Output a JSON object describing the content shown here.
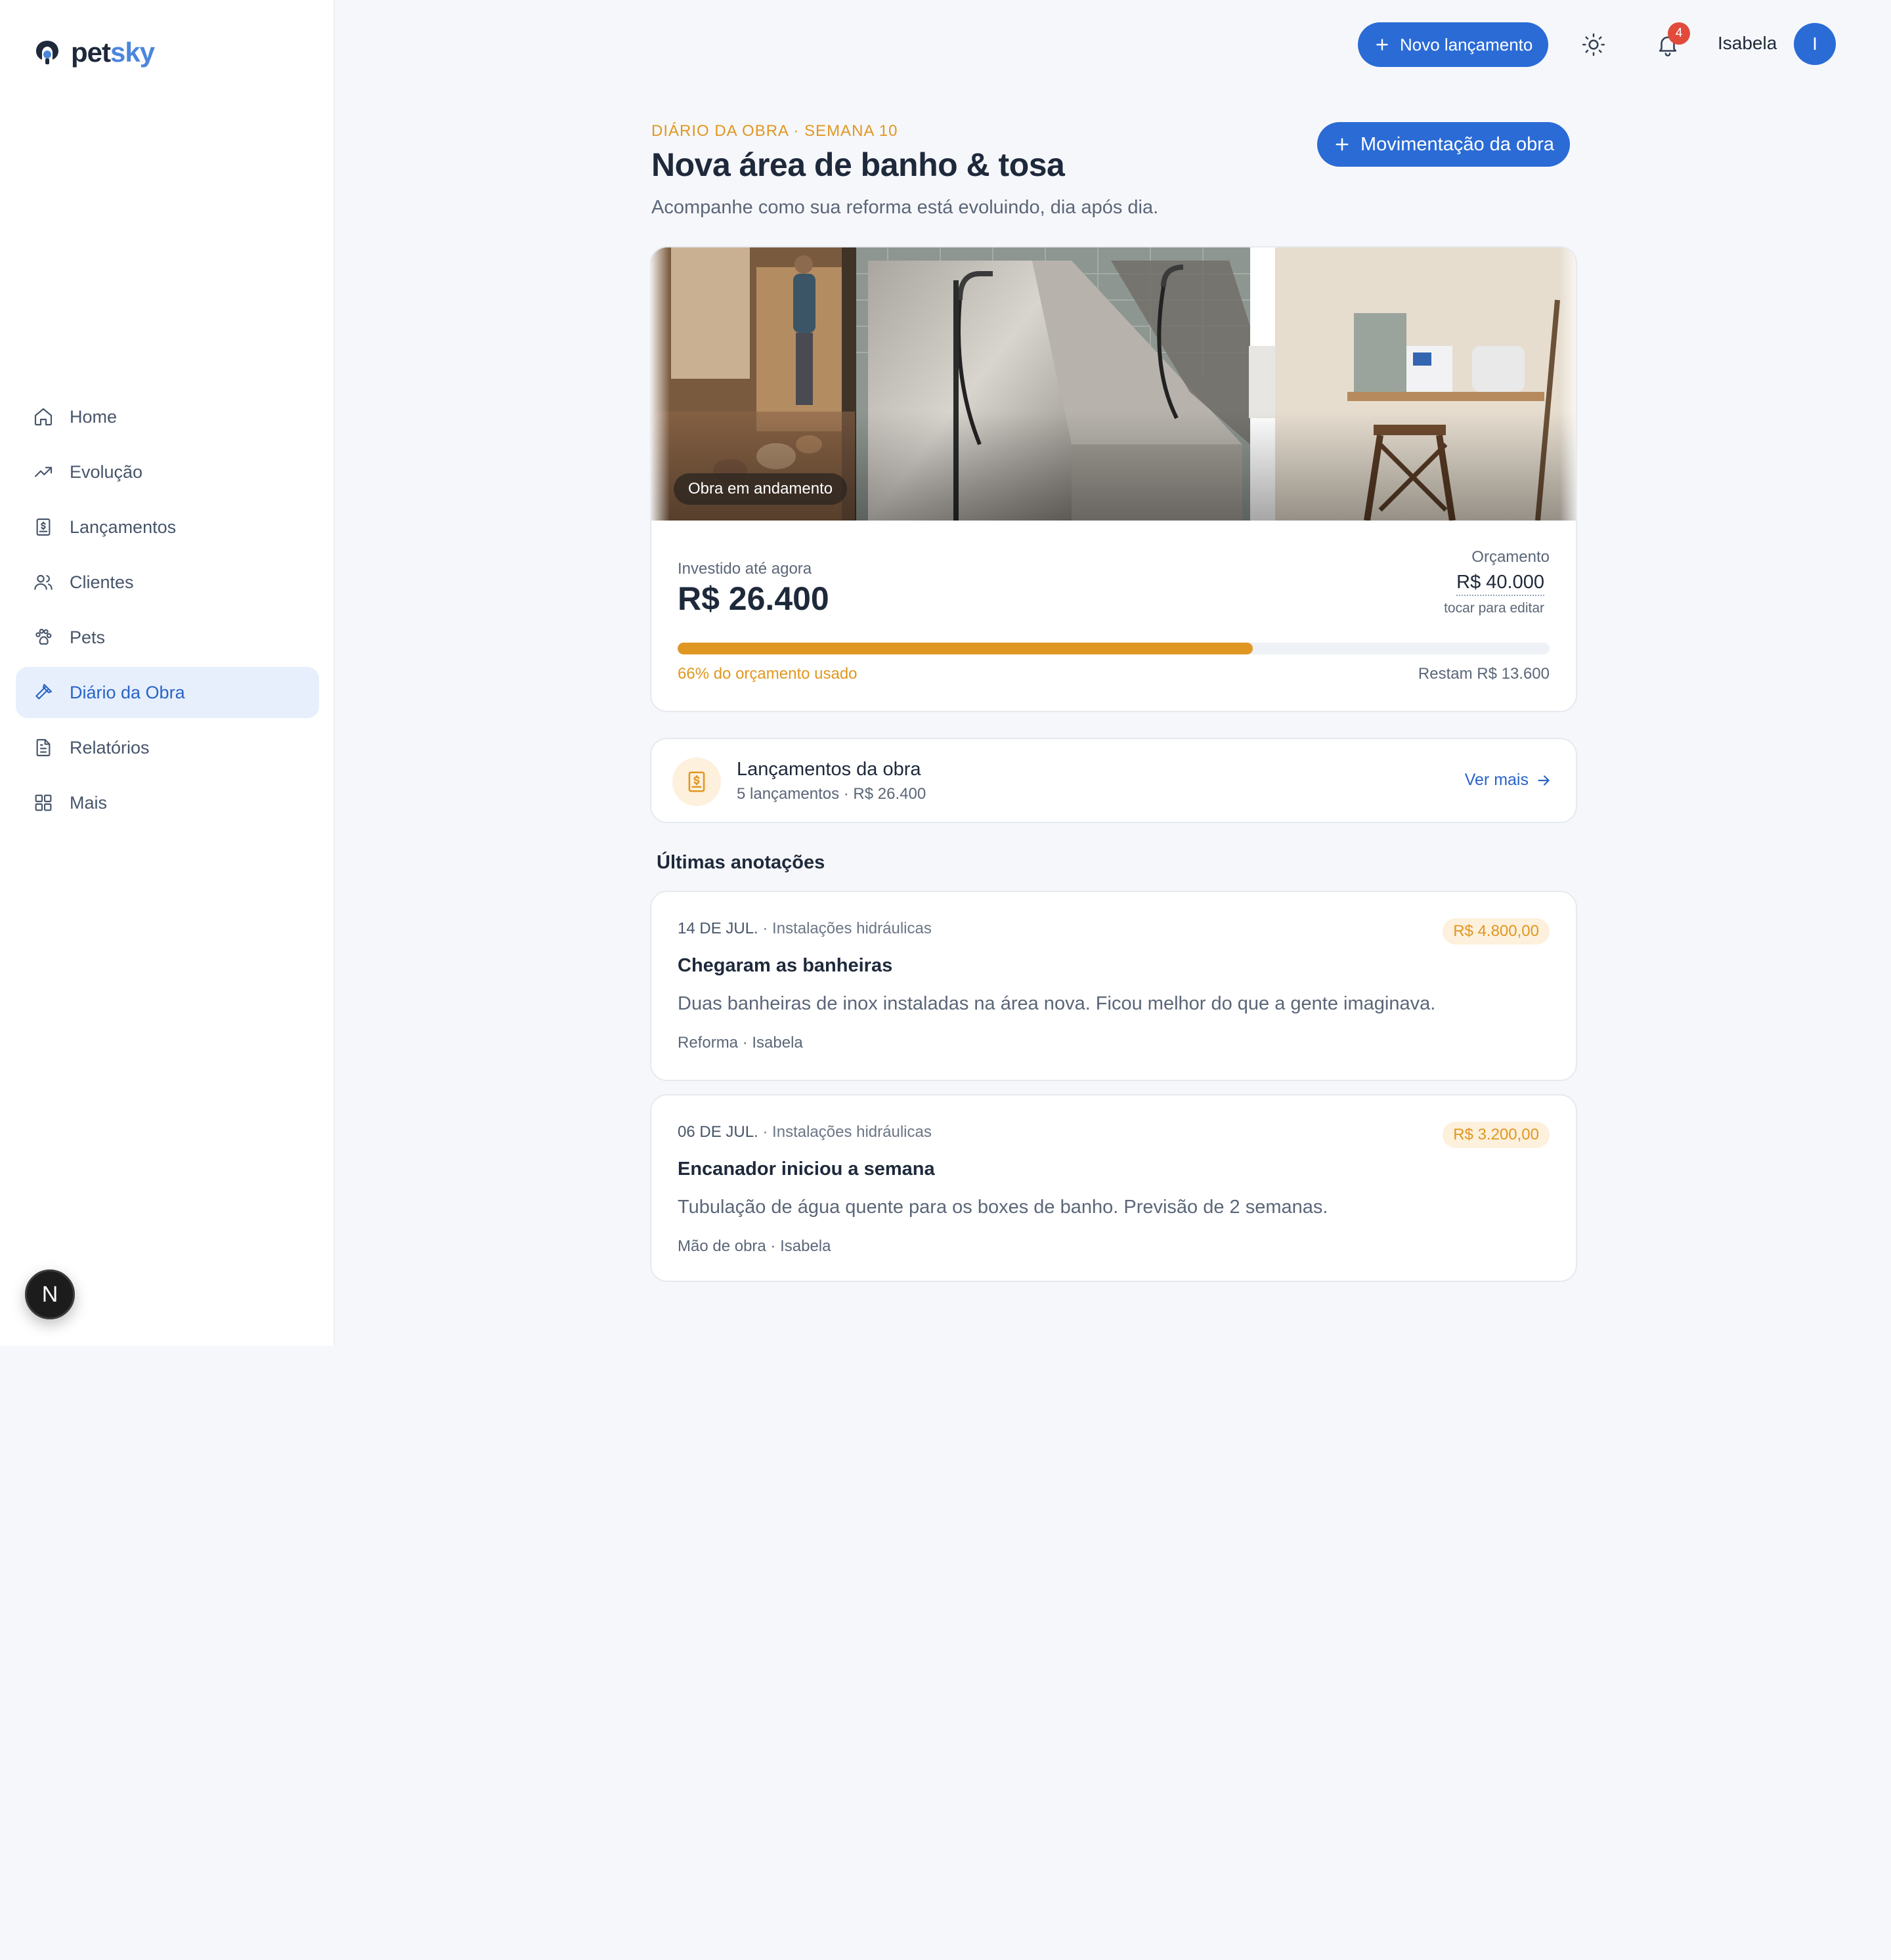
{
  "brand": {
    "part1": "pet",
    "part2": "sky"
  },
  "sidebar": {
    "items": [
      {
        "label": "Home",
        "icon": "home-icon"
      },
      {
        "label": "Evolução",
        "icon": "trending-up-icon"
      },
      {
        "label": "Lançamentos",
        "icon": "receipt-icon"
      },
      {
        "label": "Clientes",
        "icon": "users-icon"
      },
      {
        "label": "Pets",
        "icon": "paw-icon"
      },
      {
        "label": "Diário da Obra",
        "icon": "hammer-icon",
        "active": true
      },
      {
        "label": "Relatórios",
        "icon": "document-icon"
      },
      {
        "label": "Mais",
        "icon": "grid-icon"
      }
    ],
    "dev_badge": "N"
  },
  "topbar": {
    "new_button": "Novo lançamento",
    "notifications_count": "4",
    "user_name": "Isabela",
    "avatar_initial": "I"
  },
  "page": {
    "eyebrow": "DIÁRIO DA OBRA · SEMANA 10",
    "title": "Nova área de banho & tosa",
    "subtitle": "Acompanhe como sua reforma está evoluindo, dia após dia.",
    "action_button": "Movimentação da obra"
  },
  "hero": {
    "status_chip": "Obra em andamento",
    "invested_label": "Investido até agora",
    "invested_value": "R$ 26.400",
    "budget_label": "Orçamento",
    "budget_value": "R$ 40.000",
    "budget_hint": "tocar para editar",
    "progress_percent": 66,
    "progress_label": "66% do orçamento usado",
    "remaining_label": "Restam R$ 13.600"
  },
  "entries_card": {
    "title": "Lançamentos da obra",
    "subtitle": "5 lançamentos · R$ 26.400",
    "link": "Ver mais"
  },
  "notes_section": {
    "title": "Últimas anotações",
    "notes": [
      {
        "date": "14 DE JUL.",
        "category": " · Instalações hidráulicas",
        "amount": "R$ 4.800,00",
        "title": "Chegaram as banheiras",
        "body": "Duas banheiras de inox instaladas na área nova. Ficou melhor do que a gente imaginava.",
        "meta": "Reforma · Isabela"
      },
      {
        "date": "06 DE JUL.",
        "category": " · Instalações hidráulicas",
        "amount": "R$ 3.200,00",
        "title": "Encanador iniciou a semana",
        "body": "Tubulação de água quente para os boxes de banho. Previsão de 2 semanas.",
        "meta": "Mão de obra · Isabela"
      }
    ]
  },
  "colors": {
    "primary": "#2a6bd6",
    "accent": "#e09722",
    "badge": "#e14b3b",
    "active_bg": "#e7effc"
  }
}
